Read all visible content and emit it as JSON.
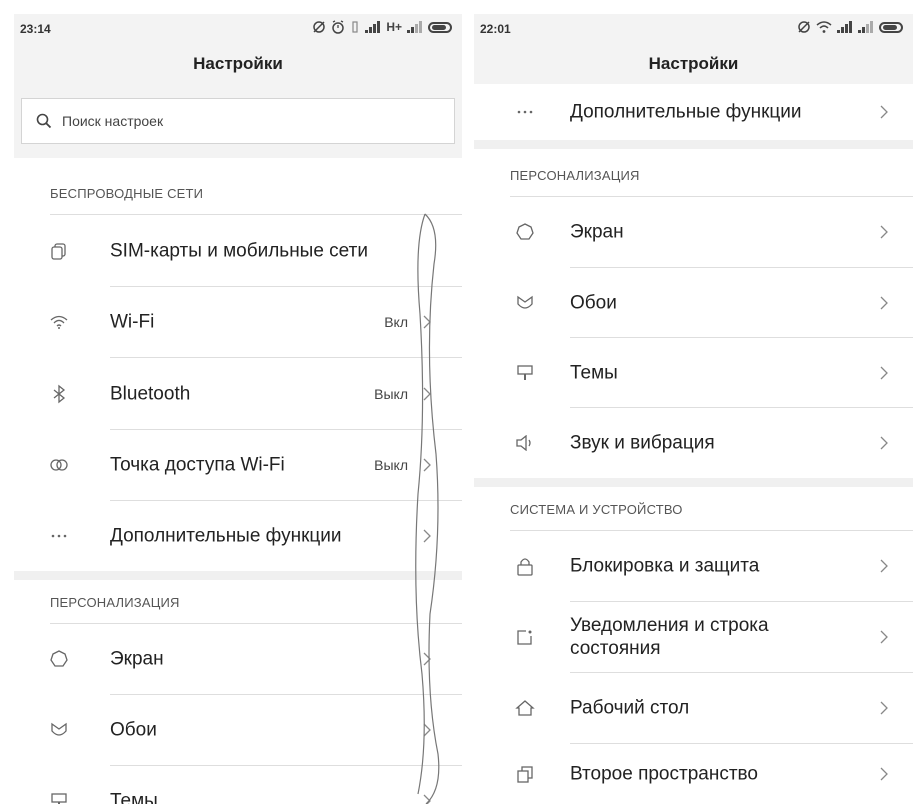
{
  "left_screen": {
    "statusbar": {
      "time": "23:14",
      "network": "H+"
    },
    "title": "Настройки",
    "search": {
      "placeholder": "Поиск настроек"
    },
    "sections": {
      "wireless": "БЕСПРОВОДНЫЕ СЕТИ",
      "personalization": "ПЕРСОНАЛИЗАЦИЯ"
    },
    "items": [
      {
        "label": "SIM-карты и мобильные сети",
        "value": "",
        "icon": "sim-icon"
      },
      {
        "label": "Wi-Fi",
        "value": "Вкл",
        "icon": "wifi-icon"
      },
      {
        "label": "Bluetooth",
        "value": "Выкл",
        "icon": "bluetooth-icon"
      },
      {
        "label": "Точка доступа Wi-Fi",
        "value": "Выкл",
        "icon": "hotspot-icon"
      },
      {
        "label": "Дополнительные функции",
        "value": "",
        "icon": "more-icon"
      },
      {
        "label": "Экран",
        "value": "",
        "icon": "brightness-icon"
      },
      {
        "label": "Обои",
        "value": "",
        "icon": "wallpaper-icon"
      },
      {
        "label": "Темы",
        "value": "",
        "icon": "themes-icon"
      }
    ]
  },
  "right_screen": {
    "statusbar": {
      "time": "22:01"
    },
    "title": "Настройки",
    "sections": {
      "personalization": "ПЕРСОНАЛИЗАЦИЯ",
      "system": "СИСТЕМА И УСТРОЙСТВО"
    },
    "items": [
      {
        "label": "Дополнительные функции",
        "icon": "more-icon"
      },
      {
        "label": "Экран",
        "icon": "brightness-icon"
      },
      {
        "label": "Обои",
        "icon": "wallpaper-icon"
      },
      {
        "label": "Темы",
        "icon": "themes-icon"
      },
      {
        "label": "Звук и вибрация",
        "icon": "sound-icon"
      },
      {
        "label": "Блокировка и защита",
        "icon": "lock-icon"
      },
      {
        "label": "Уведомления и строка состояния",
        "icon": "notification-icon"
      },
      {
        "label": "Рабочий стол",
        "icon": "home-icon"
      },
      {
        "label": "Второе пространство",
        "icon": "second-space-icon"
      }
    ]
  }
}
